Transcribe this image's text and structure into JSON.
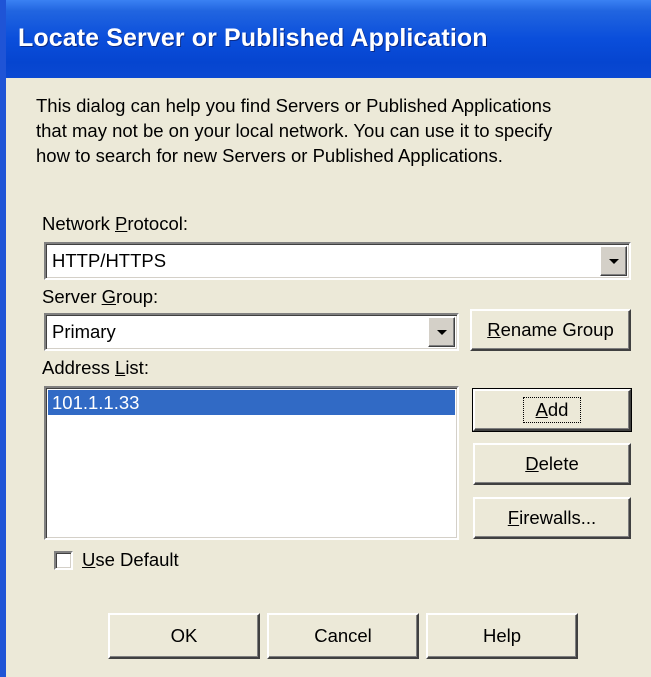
{
  "dialog": {
    "title": "Locate Server or Published Application",
    "description": [
      "This dialog can help you find Servers or Published Applications",
      "that may not be on your local network.  You can use it to specify",
      "how to search for new Servers or Published Applications."
    ]
  },
  "network_protocol": {
    "label_pre": "Network ",
    "label_accel": "P",
    "label_post": "rotocol:",
    "value": "HTTP/HTTPS"
  },
  "server_group": {
    "label_pre": "Server ",
    "label_accel": "G",
    "label_post": "roup:",
    "value": "Primary",
    "rename_accel": "R",
    "rename_rest": "ename Group"
  },
  "address_list": {
    "label_pre": "Address ",
    "label_accel": "L",
    "label_post": "ist:",
    "items": [
      "101.1.1.33"
    ]
  },
  "side_buttons": {
    "add_accel": "A",
    "add_rest": "dd",
    "delete_accel": "D",
    "delete_rest": "elete",
    "firewalls_accel": "F",
    "firewalls_rest": "irewalls..."
  },
  "use_default": {
    "accel": "U",
    "rest": "se Default",
    "checked": false
  },
  "footer": {
    "ok": "OK",
    "cancel": "Cancel",
    "help": "Help"
  }
}
